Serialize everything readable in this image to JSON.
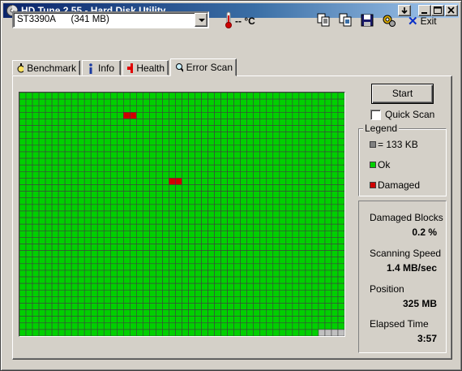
{
  "window": {
    "title": "HD Tune 2.55 - Hard Disk Utility"
  },
  "toolbar": {
    "drive_selected": "ST3390A      (341 MB)",
    "temperature": "-- °C",
    "exit_label": "Exit",
    "icons": [
      "copy-text-icon",
      "copy-screenshot-icon",
      "save-icon",
      "options-icon"
    ]
  },
  "tabs": [
    {
      "label": "Benchmark",
      "icon": "stopwatch-icon",
      "active": false
    },
    {
      "label": "Info",
      "icon": "info-icon",
      "active": false
    },
    {
      "label": "Health",
      "icon": "health-cross-icon",
      "active": false
    },
    {
      "label": "Error Scan",
      "icon": "magnifier-icon",
      "active": true
    }
  ],
  "scan": {
    "columns": 50,
    "rows": 37,
    "unscanned_tail_blocks": 4,
    "damaged_blocks": [
      [
        3,
        16
      ],
      [
        3,
        17
      ],
      [
        13,
        23
      ],
      [
        13,
        24
      ]
    ],
    "colors": {
      "ok": "#00d000",
      "damaged": "#d00000",
      "unscanned": "#c0c0c0",
      "grid_line": "#404040"
    }
  },
  "controls": {
    "start_label": "Start",
    "quick_scan_label": "Quick Scan",
    "quick_scan_checked": false
  },
  "legend": {
    "title": "Legend",
    "block_size": "= 133 KB",
    "ok": "Ok",
    "damaged": "Damaged"
  },
  "stats": {
    "damaged_blocks_label": "Damaged Blocks",
    "damaged_blocks_value": "0.2 %",
    "scanning_speed_label": "Scanning Speed",
    "scanning_speed_value": "1.4 MB/sec",
    "position_label": "Position",
    "position_value": "325 MB",
    "elapsed_time_label": "Elapsed Time",
    "elapsed_time_value": "3:57"
  }
}
